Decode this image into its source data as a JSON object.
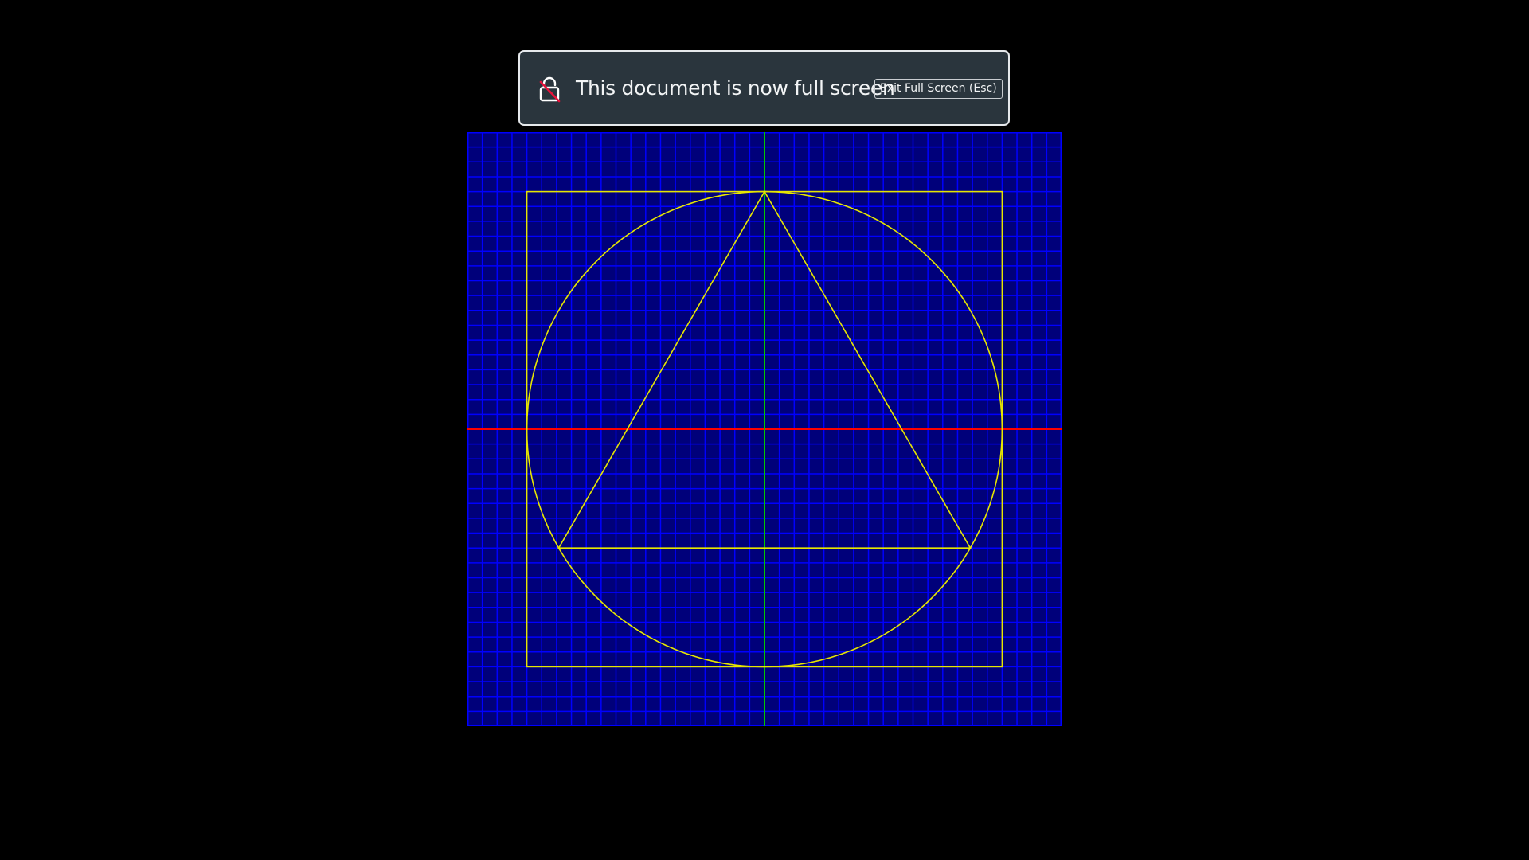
{
  "banner": {
    "message": "This document is now full screen",
    "exit_button_label": "Exit Full Screen (Esc)",
    "icon": "lock-icon"
  },
  "canvas": {
    "colors": {
      "background": "#00007a",
      "grid": "#0000ff",
      "horizontal_axis": "#ff0000",
      "vertical_axis": "#00c800",
      "shapes": "#e6e600"
    },
    "grid_divisions": 40,
    "shapes": [
      "square",
      "circle",
      "triangle"
    ]
  }
}
